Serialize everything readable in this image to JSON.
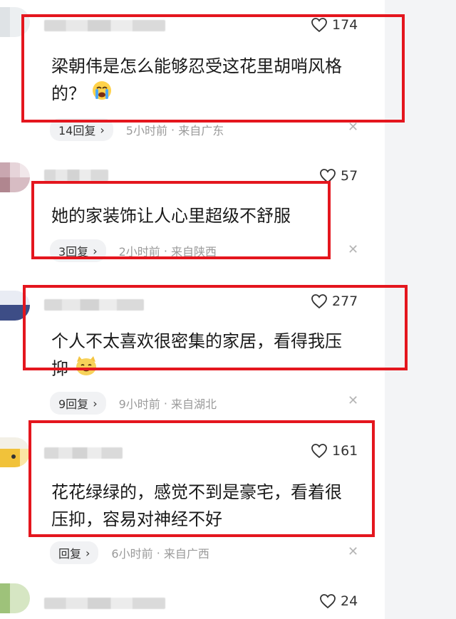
{
  "comments": [
    {
      "likes": "174",
      "text_line1": "梁朝伟是怎么能够忍受这花里胡哨风格",
      "text_line2": "的？",
      "emoji": "crying-face-icon",
      "replies": "14回复",
      "time": "5小时前",
      "location": "来自广东"
    },
    {
      "likes": "57",
      "text_line1": "她的家装饰让人心里超级不舒服",
      "replies": "3回复",
      "time": "2小时前",
      "location": "来自陕西"
    },
    {
      "likes": "277",
      "text_line1": "个人不太喜欢很密集的家居，看得我压",
      "text_line2": "抑",
      "emoji": "cat-face-icon",
      "replies": "9回复",
      "time": "9小时前",
      "location": "来自湖北"
    },
    {
      "likes": "161",
      "text_line1": "花花绿绿的，感觉不到是豪宅，看着很",
      "text_line2": "压抑，容易对神经不好",
      "replies": "回复",
      "time": "6小时前",
      "location": "来自广西"
    },
    {
      "likes": "24"
    }
  ],
  "colors": {
    "highlight_box": "#e4161e",
    "meta_text": "#9a9a9a",
    "gutter": "#f3f4f6"
  }
}
